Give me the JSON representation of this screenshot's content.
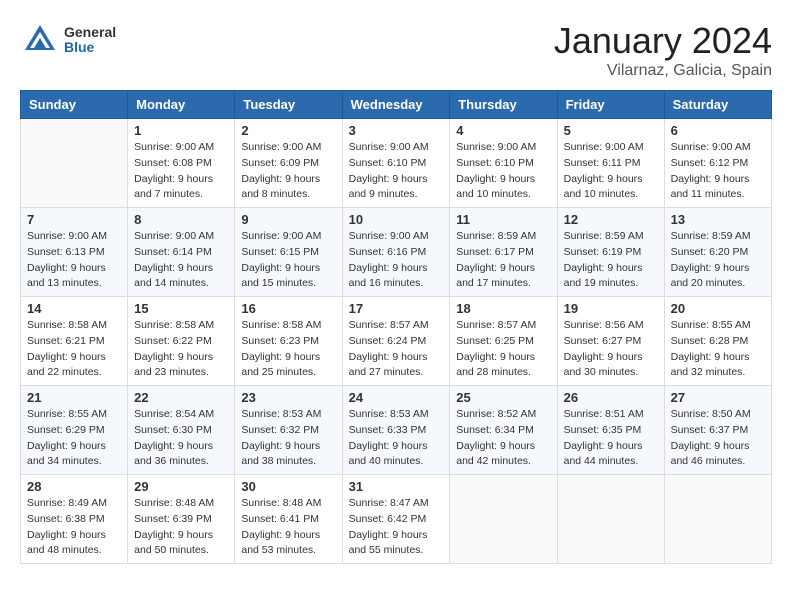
{
  "header": {
    "logo_general": "General",
    "logo_blue": "Blue",
    "month_title": "January 2024",
    "location": "Vilarnaz, Galicia, Spain"
  },
  "days_of_week": [
    "Sunday",
    "Monday",
    "Tuesday",
    "Wednesday",
    "Thursday",
    "Friday",
    "Saturday"
  ],
  "weeks": [
    [
      {
        "day": "",
        "info": ""
      },
      {
        "day": "1",
        "sunrise": "Sunrise: 9:00 AM",
        "sunset": "Sunset: 6:08 PM",
        "daylight": "Daylight: 9 hours and 7 minutes."
      },
      {
        "day": "2",
        "sunrise": "Sunrise: 9:00 AM",
        "sunset": "Sunset: 6:09 PM",
        "daylight": "Daylight: 9 hours and 8 minutes."
      },
      {
        "day": "3",
        "sunrise": "Sunrise: 9:00 AM",
        "sunset": "Sunset: 6:10 PM",
        "daylight": "Daylight: 9 hours and 9 minutes."
      },
      {
        "day": "4",
        "sunrise": "Sunrise: 9:00 AM",
        "sunset": "Sunset: 6:10 PM",
        "daylight": "Daylight: 9 hours and 10 minutes."
      },
      {
        "day": "5",
        "sunrise": "Sunrise: 9:00 AM",
        "sunset": "Sunset: 6:11 PM",
        "daylight": "Daylight: 9 hours and 10 minutes."
      },
      {
        "day": "6",
        "sunrise": "Sunrise: 9:00 AM",
        "sunset": "Sunset: 6:12 PM",
        "daylight": "Daylight: 9 hours and 11 minutes."
      }
    ],
    [
      {
        "day": "7",
        "sunrise": "Sunrise: 9:00 AM",
        "sunset": "Sunset: 6:13 PM",
        "daylight": "Daylight: 9 hours and 13 minutes."
      },
      {
        "day": "8",
        "sunrise": "Sunrise: 9:00 AM",
        "sunset": "Sunset: 6:14 PM",
        "daylight": "Daylight: 9 hours and 14 minutes."
      },
      {
        "day": "9",
        "sunrise": "Sunrise: 9:00 AM",
        "sunset": "Sunset: 6:15 PM",
        "daylight": "Daylight: 9 hours and 15 minutes."
      },
      {
        "day": "10",
        "sunrise": "Sunrise: 9:00 AM",
        "sunset": "Sunset: 6:16 PM",
        "daylight": "Daylight: 9 hours and 16 minutes."
      },
      {
        "day": "11",
        "sunrise": "Sunrise: 8:59 AM",
        "sunset": "Sunset: 6:17 PM",
        "daylight": "Daylight: 9 hours and 17 minutes."
      },
      {
        "day": "12",
        "sunrise": "Sunrise: 8:59 AM",
        "sunset": "Sunset: 6:19 PM",
        "daylight": "Daylight: 9 hours and 19 minutes."
      },
      {
        "day": "13",
        "sunrise": "Sunrise: 8:59 AM",
        "sunset": "Sunset: 6:20 PM",
        "daylight": "Daylight: 9 hours and 20 minutes."
      }
    ],
    [
      {
        "day": "14",
        "sunrise": "Sunrise: 8:58 AM",
        "sunset": "Sunset: 6:21 PM",
        "daylight": "Daylight: 9 hours and 22 minutes."
      },
      {
        "day": "15",
        "sunrise": "Sunrise: 8:58 AM",
        "sunset": "Sunset: 6:22 PM",
        "daylight": "Daylight: 9 hours and 23 minutes."
      },
      {
        "day": "16",
        "sunrise": "Sunrise: 8:58 AM",
        "sunset": "Sunset: 6:23 PM",
        "daylight": "Daylight: 9 hours and 25 minutes."
      },
      {
        "day": "17",
        "sunrise": "Sunrise: 8:57 AM",
        "sunset": "Sunset: 6:24 PM",
        "daylight": "Daylight: 9 hours and 27 minutes."
      },
      {
        "day": "18",
        "sunrise": "Sunrise: 8:57 AM",
        "sunset": "Sunset: 6:25 PM",
        "daylight": "Daylight: 9 hours and 28 minutes."
      },
      {
        "day": "19",
        "sunrise": "Sunrise: 8:56 AM",
        "sunset": "Sunset: 6:27 PM",
        "daylight": "Daylight: 9 hours and 30 minutes."
      },
      {
        "day": "20",
        "sunrise": "Sunrise: 8:55 AM",
        "sunset": "Sunset: 6:28 PM",
        "daylight": "Daylight: 9 hours and 32 minutes."
      }
    ],
    [
      {
        "day": "21",
        "sunrise": "Sunrise: 8:55 AM",
        "sunset": "Sunset: 6:29 PM",
        "daylight": "Daylight: 9 hours and 34 minutes."
      },
      {
        "day": "22",
        "sunrise": "Sunrise: 8:54 AM",
        "sunset": "Sunset: 6:30 PM",
        "daylight": "Daylight: 9 hours and 36 minutes."
      },
      {
        "day": "23",
        "sunrise": "Sunrise: 8:53 AM",
        "sunset": "Sunset: 6:32 PM",
        "daylight": "Daylight: 9 hours and 38 minutes."
      },
      {
        "day": "24",
        "sunrise": "Sunrise: 8:53 AM",
        "sunset": "Sunset: 6:33 PM",
        "daylight": "Daylight: 9 hours and 40 minutes."
      },
      {
        "day": "25",
        "sunrise": "Sunrise: 8:52 AM",
        "sunset": "Sunset: 6:34 PM",
        "daylight": "Daylight: 9 hours and 42 minutes."
      },
      {
        "day": "26",
        "sunrise": "Sunrise: 8:51 AM",
        "sunset": "Sunset: 6:35 PM",
        "daylight": "Daylight: 9 hours and 44 minutes."
      },
      {
        "day": "27",
        "sunrise": "Sunrise: 8:50 AM",
        "sunset": "Sunset: 6:37 PM",
        "daylight": "Daylight: 9 hours and 46 minutes."
      }
    ],
    [
      {
        "day": "28",
        "sunrise": "Sunrise: 8:49 AM",
        "sunset": "Sunset: 6:38 PM",
        "daylight": "Daylight: 9 hours and 48 minutes."
      },
      {
        "day": "29",
        "sunrise": "Sunrise: 8:48 AM",
        "sunset": "Sunset: 6:39 PM",
        "daylight": "Daylight: 9 hours and 50 minutes."
      },
      {
        "day": "30",
        "sunrise": "Sunrise: 8:48 AM",
        "sunset": "Sunset: 6:41 PM",
        "daylight": "Daylight: 9 hours and 53 minutes."
      },
      {
        "day": "31",
        "sunrise": "Sunrise: 8:47 AM",
        "sunset": "Sunset: 6:42 PM",
        "daylight": "Daylight: 9 hours and 55 minutes."
      },
      {
        "day": "",
        "info": ""
      },
      {
        "day": "",
        "info": ""
      },
      {
        "day": "",
        "info": ""
      }
    ]
  ]
}
